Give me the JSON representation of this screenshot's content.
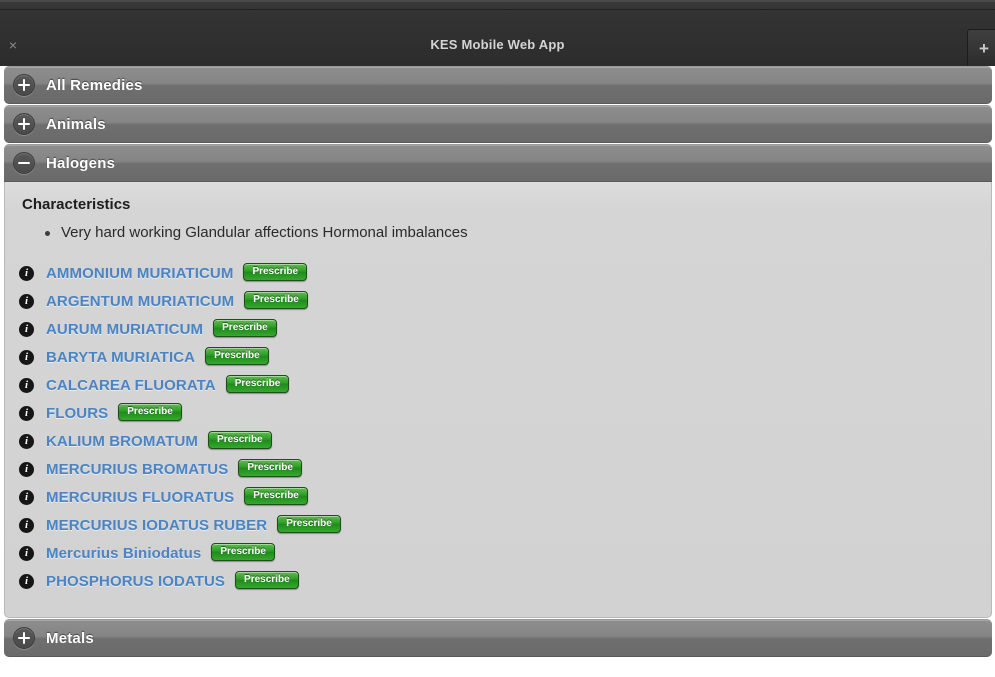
{
  "window": {
    "title": "KES Mobile Web App",
    "close_label": "×",
    "add_label": "+"
  },
  "colors": {
    "header_gradient_top": "#8e8e8e",
    "header_gradient_bottom": "#6a6a6a",
    "panel_background": "#d5d5d5",
    "link_blue": "#4a84c4",
    "prescribe_green": "#2f9c28",
    "titlebar_dark": "#2c2c2c"
  },
  "accordion": {
    "sections": [
      {
        "label": "All Remedies",
        "expanded": false,
        "toggle_icon": "plus-icon"
      },
      {
        "label": "Animals",
        "expanded": false,
        "toggle_icon": "plus-icon"
      },
      {
        "label": "Halogens",
        "expanded": true,
        "toggle_icon": "minus-icon"
      },
      {
        "label": "Metals",
        "expanded": false,
        "toggle_icon": "plus-icon"
      }
    ]
  },
  "panel": {
    "heading": "Characteristics",
    "characteristics": [
      "Very hard working Glandular affections Hormonal imbalances"
    ],
    "prescribe_label": "Prescribe",
    "info_icon_glyph": "i",
    "remedies": [
      {
        "name": "AMMONIUM MURIATICUM"
      },
      {
        "name": "ARGENTUM MURIATICUM"
      },
      {
        "name": "AURUM MURIATICUM"
      },
      {
        "name": "BARYTA MURIATICA"
      },
      {
        "name": "CALCAREA FLUORATA"
      },
      {
        "name": "FLOURS"
      },
      {
        "name": "KALIUM BROMATUM"
      },
      {
        "name": "MERCURIUS BROMATUS"
      },
      {
        "name": "MERCURIUS FLUORATUS"
      },
      {
        "name": "MERCURIUS IODATUS RUBER"
      },
      {
        "name": "Mercurius Biniodatus"
      },
      {
        "name": "PHOSPHORUS IODATUS"
      }
    ]
  }
}
